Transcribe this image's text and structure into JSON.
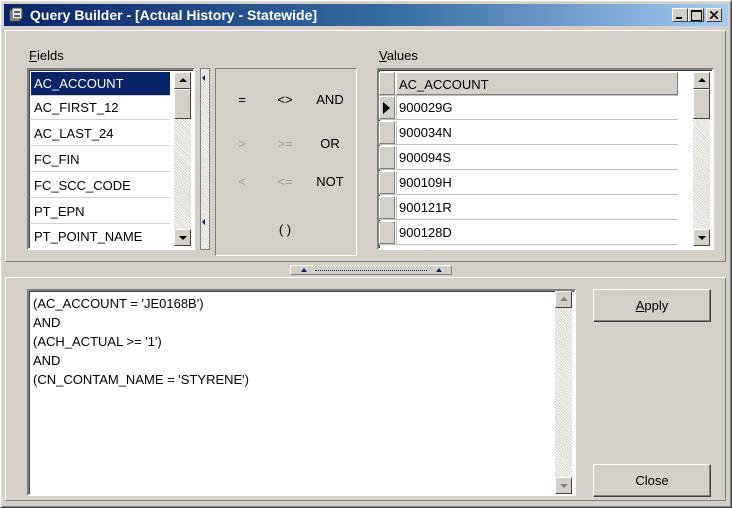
{
  "window": {
    "title": "Query Builder - [Actual History - Statewide]"
  },
  "fields": {
    "label_accel": "F",
    "label_rest": "ields",
    "items": [
      "AC_ACCOUNT",
      "AC_FIRST_12",
      "AC_LAST_24",
      "FC_FIN",
      "FC_SCC_CODE",
      "PT_EPN",
      "PT_POINT_NAME"
    ],
    "selected": "AC_ACCOUNT"
  },
  "operators": {
    "row1": [
      "=",
      "<>",
      "AND"
    ],
    "row2": [
      ">",
      ">=",
      "OR"
    ],
    "row3": [
      "<",
      "<=",
      "NOT"
    ],
    "row4": [
      "( )"
    ]
  },
  "values": {
    "label_accel": "V",
    "label_rest": "alues",
    "column_header": "AC_ACCOUNT",
    "rows": [
      "900029G",
      "900034N",
      "900094S",
      "900109H",
      "900121R",
      "900128D"
    ]
  },
  "query": {
    "lines": [
      "(AC_ACCOUNT = 'JE0168B')",
      "AND",
      "(ACH_ACTUAL >= '1')",
      "AND",
      "(CN_CONTAM_NAME = 'STYRENE')"
    ]
  },
  "buttons": {
    "apply_accel": "A",
    "apply_rest": "pply",
    "close": "Close"
  },
  "colors": {
    "title_bar": "#0a246a",
    "face": "#d4d0c8",
    "selection": "#0a246a"
  }
}
